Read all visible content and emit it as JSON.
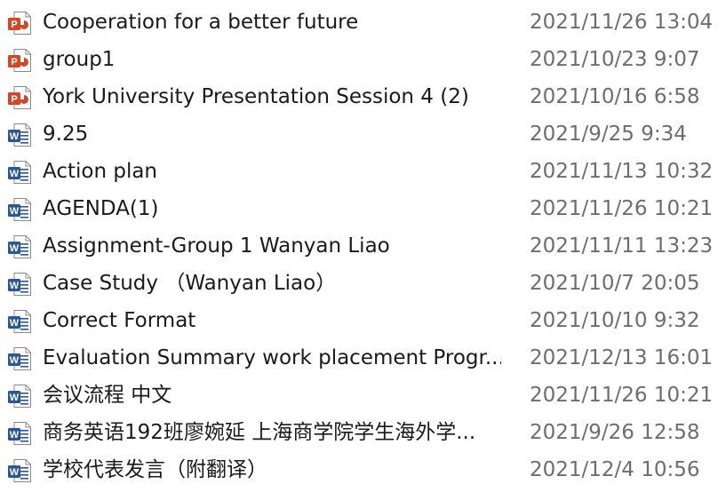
{
  "colors": {
    "powerpoint": "#d24726",
    "word": "#2b5797",
    "name_text": "#1a1a1a",
    "date_text": "#6d6d6d"
  },
  "files": [
    {
      "name": "Cooperation for a better future",
      "modified": "2021/11/26 13:04",
      "icon": "powerpoint-file-icon",
      "badge": "P"
    },
    {
      "name": "group1",
      "modified": "2021/10/23 9:07",
      "icon": "powerpoint-file-icon",
      "badge": "P"
    },
    {
      "name": "York University Presentation Session 4 (2)",
      "modified": "2021/10/16 6:58",
      "icon": "powerpoint-file-icon",
      "badge": "P"
    },
    {
      "name": "9.25",
      "modified": "2021/9/25 9:34",
      "icon": "word-file-icon",
      "badge": "W"
    },
    {
      "name": "Action plan",
      "modified": "2021/11/13 10:32",
      "icon": "word-file-icon",
      "badge": "W"
    },
    {
      "name": "AGENDA(1)",
      "modified": "2021/11/26 10:21",
      "icon": "word-file-icon",
      "badge": "W"
    },
    {
      "name": "Assignment-Group 1 Wanyan Liao",
      "modified": "2021/11/11 13:23",
      "icon": "word-file-icon",
      "badge": "W"
    },
    {
      "name": "Case Study （Wanyan Liao）",
      "modified": "2021/10/7 20:05",
      "icon": "word-file-icon",
      "badge": "W"
    },
    {
      "name": "Correct Format",
      "modified": "2021/10/10 9:32",
      "icon": "word-file-icon",
      "badge": "W"
    },
    {
      "name": "Evaluation Summary work placement Progr...",
      "modified": "2021/12/13 16:01",
      "icon": "word-file-icon",
      "badge": "W"
    },
    {
      "name": "会议流程 中文",
      "modified": "2021/11/26 10:21",
      "icon": "word-file-icon",
      "badge": "W"
    },
    {
      "name": "商务英语192班廖婉延 上海商学院学生海外学...",
      "modified": "2021/9/26 12:58",
      "icon": "word-file-icon",
      "badge": "W"
    },
    {
      "name": "学校代表发言（附翻译）",
      "modified": "2021/12/4 10:56",
      "icon": "word-file-icon",
      "badge": "W"
    }
  ]
}
